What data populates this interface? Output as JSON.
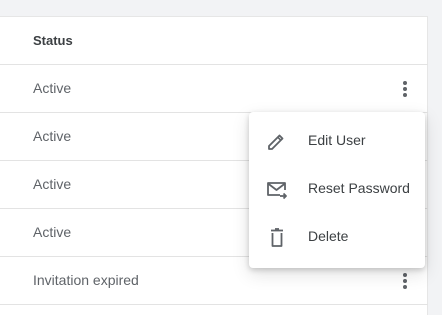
{
  "table": {
    "header": {
      "status": "Status"
    },
    "rows": [
      {
        "status": "Active"
      },
      {
        "status": "Active"
      },
      {
        "status": "Active"
      },
      {
        "status": "Active"
      },
      {
        "status": "Invitation expired"
      }
    ]
  },
  "row_menu": {
    "items": [
      {
        "label": "Edit User",
        "icon": "pencil-icon"
      },
      {
        "label": "Reset Password",
        "icon": "mail-forward-icon"
      },
      {
        "label": "Delete",
        "icon": "trash-icon"
      }
    ]
  },
  "colors": {
    "text_primary": "#3c4043",
    "text_secondary": "#5f6368",
    "divider": "#e3e3e3",
    "icon": "#5f6368"
  }
}
